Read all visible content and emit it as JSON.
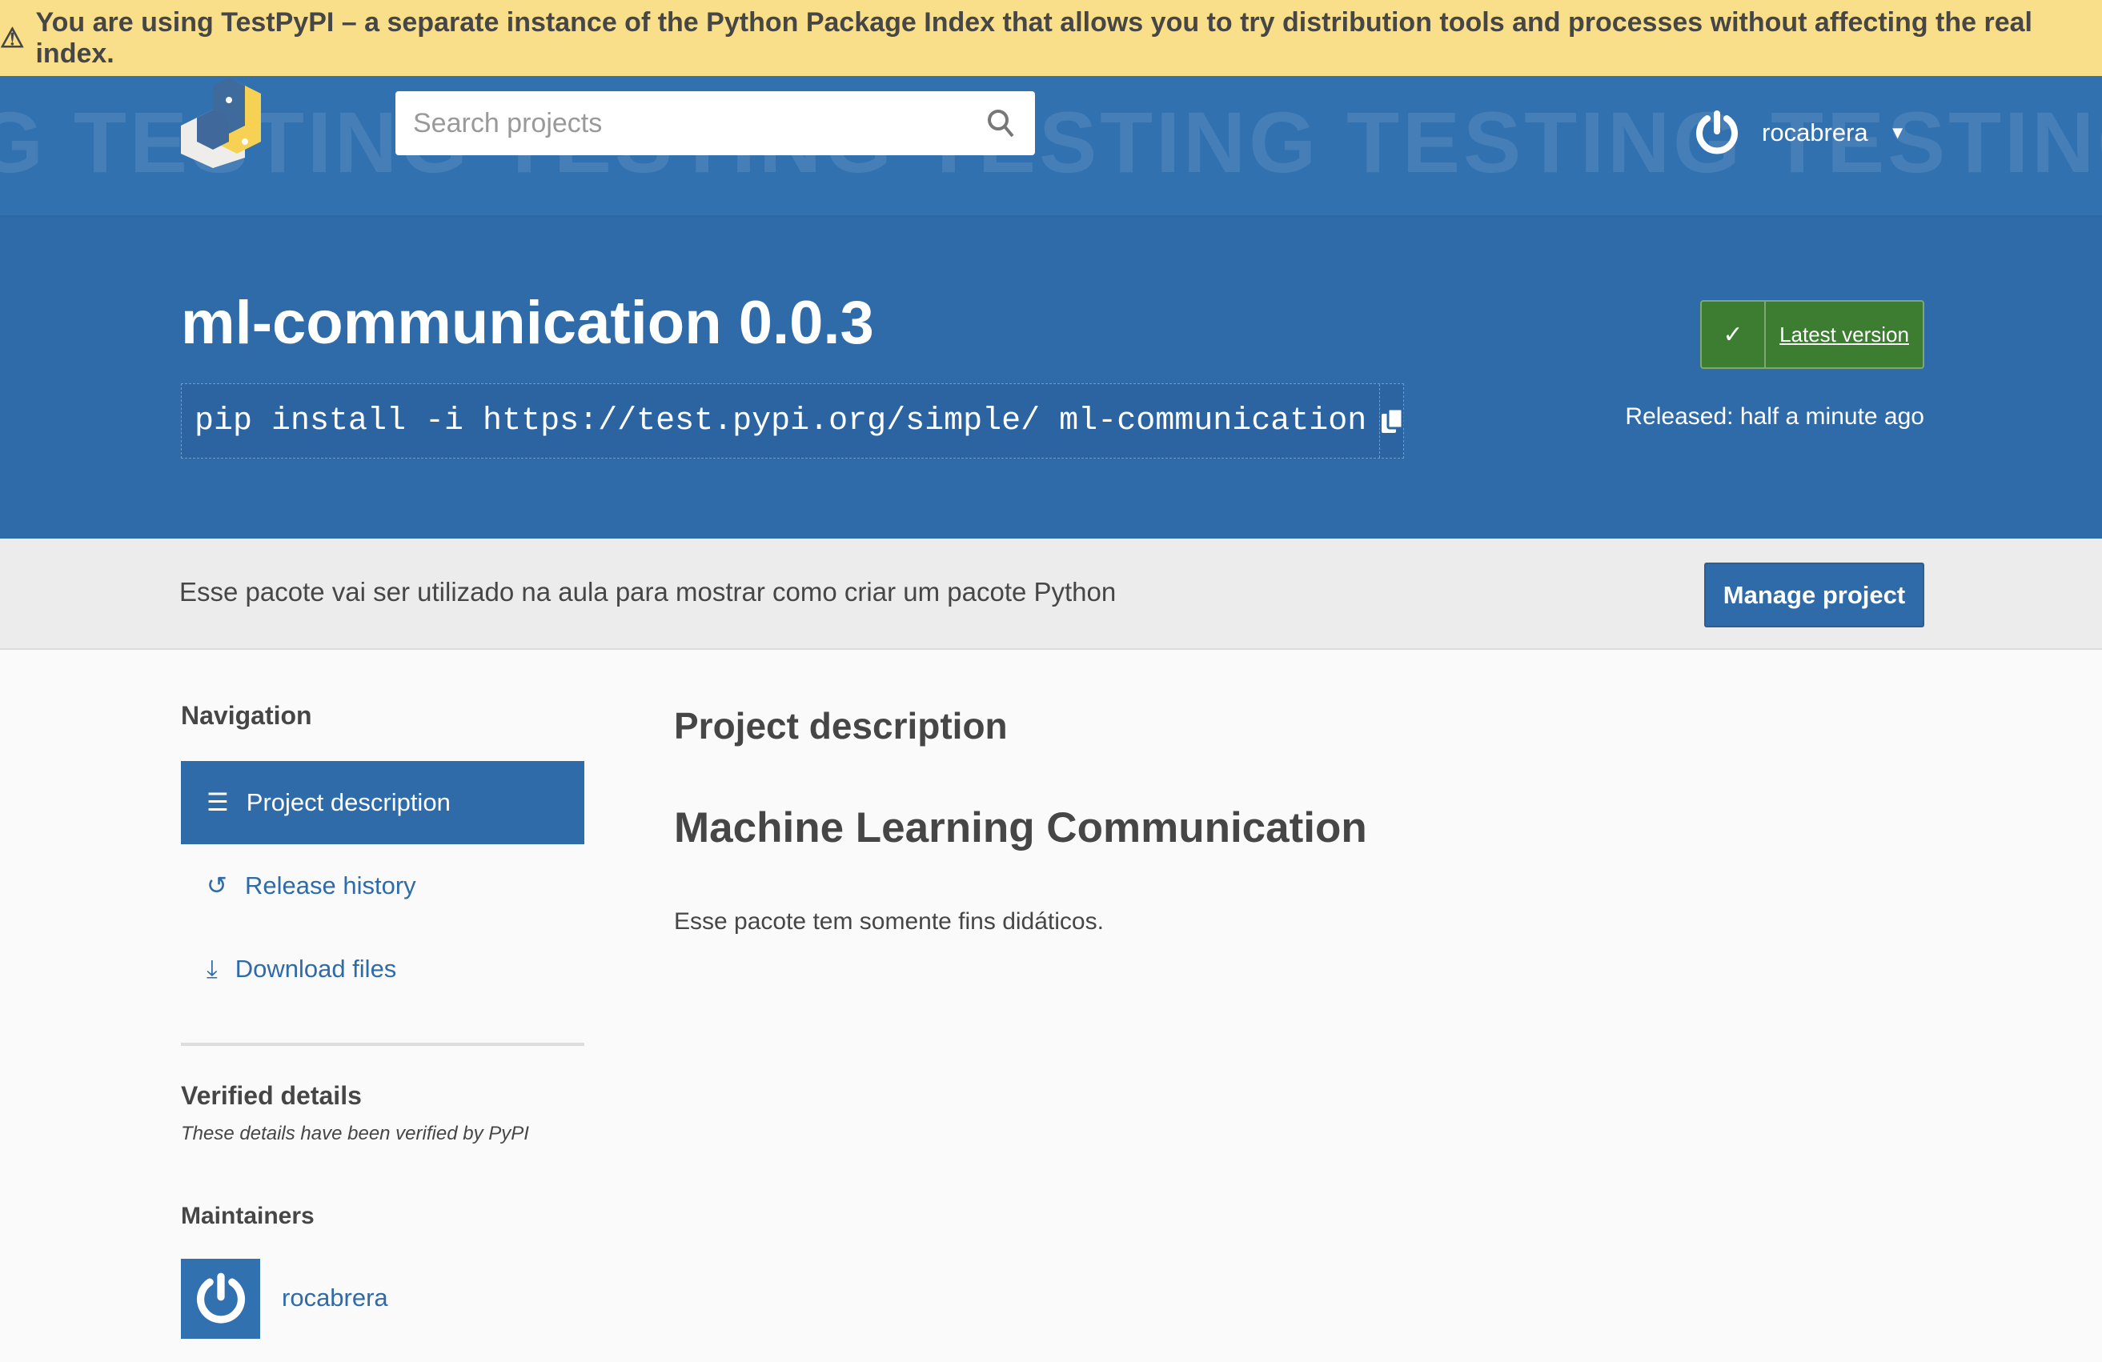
{
  "banner": {
    "icon": "warning-icon",
    "text": "You are using TestPyPI – a separate instance of the Python Package Index that allows you to try distribution tools and processes without affecting the real index."
  },
  "header": {
    "watermark": "G TESTING TESTING TESTING TESTING TESTING TESTING TESTING TESTI",
    "search_placeholder": "Search projects",
    "username": "rocabrera"
  },
  "hero": {
    "title": "ml-communication 0.0.3",
    "pip_command": "pip install -i https://test.pypi.org/simple/ ml-communication",
    "latest_label": "Latest version",
    "released": "Released: half a minute ago"
  },
  "summary": {
    "text": "Esse pacote vai ser utilizado na aula para mostrar como criar um pacote Python",
    "manage_label": "Manage project"
  },
  "sidebar": {
    "nav_heading": "Navigation",
    "items": [
      {
        "label": "Project description",
        "icon": "align-left-icon"
      },
      {
        "label": "Release history",
        "icon": "history-icon"
      },
      {
        "label": "Download files",
        "icon": "download-icon"
      }
    ],
    "verified_heading": "Verified details",
    "verified_note": "These details have been verified by PyPI",
    "maintainers_heading": "Maintainers",
    "maintainer": "rocabrera"
  },
  "main": {
    "heading": "Project description",
    "readme_title": "Machine Learning Communication",
    "readme_body": "Esse pacote tem somente fins didáticos."
  },
  "colors": {
    "banner": "#f9df89",
    "header": "#3171b0",
    "hero": "#2f6ba8",
    "latest": "#3d7d32"
  }
}
